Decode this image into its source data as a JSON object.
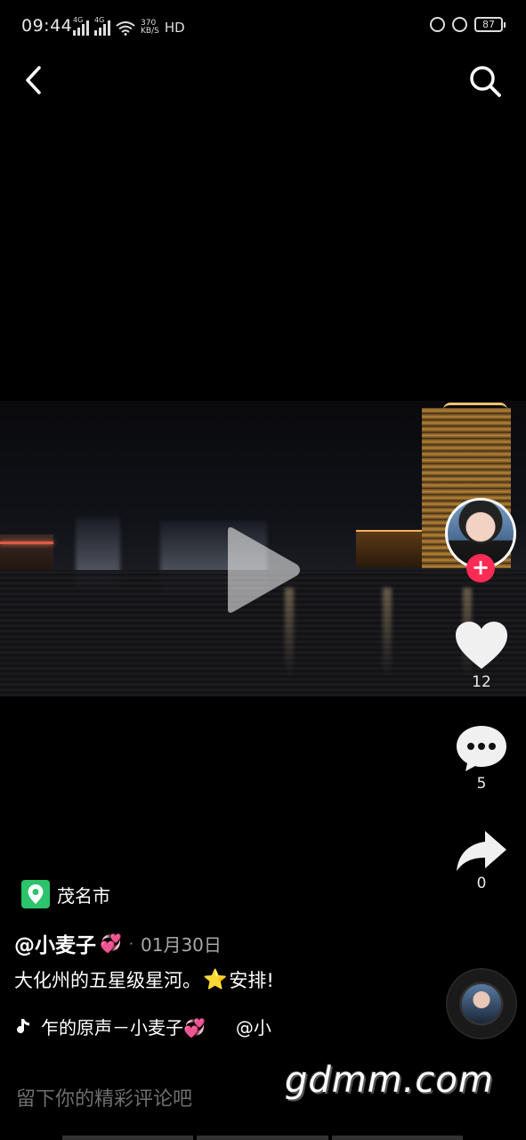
{
  "status_bar": {
    "time": "09:44",
    "net1": "4G",
    "net2": "4G",
    "speed_value": "370",
    "speed_unit": "KB/S",
    "hd": "HD",
    "battery": "87"
  },
  "nav": {
    "back_icon": "chevron-left-icon",
    "search_icon": "search-icon"
  },
  "video": {
    "play_icon": "play-icon"
  },
  "actions": {
    "like_count": "12",
    "comment_count": "5",
    "share_count": "0",
    "follow_symbol": "+"
  },
  "post": {
    "location": "茂名市",
    "author": "@小麦子",
    "author_emoji": "💞",
    "separator": "·",
    "date": "01月30日",
    "caption_before": "大化州的五星级星河。",
    "caption_emoji": "⭐",
    "caption_after": "安排!",
    "music_text": "乍的原声－小麦子💞",
    "music_mention": "@小"
  },
  "comment_bar": {
    "placeholder": "留下你的精彩评论吧"
  },
  "watermark": "gdmm.com",
  "colors": {
    "accent": "#fe2c55",
    "location_green": "#2bc46a"
  }
}
